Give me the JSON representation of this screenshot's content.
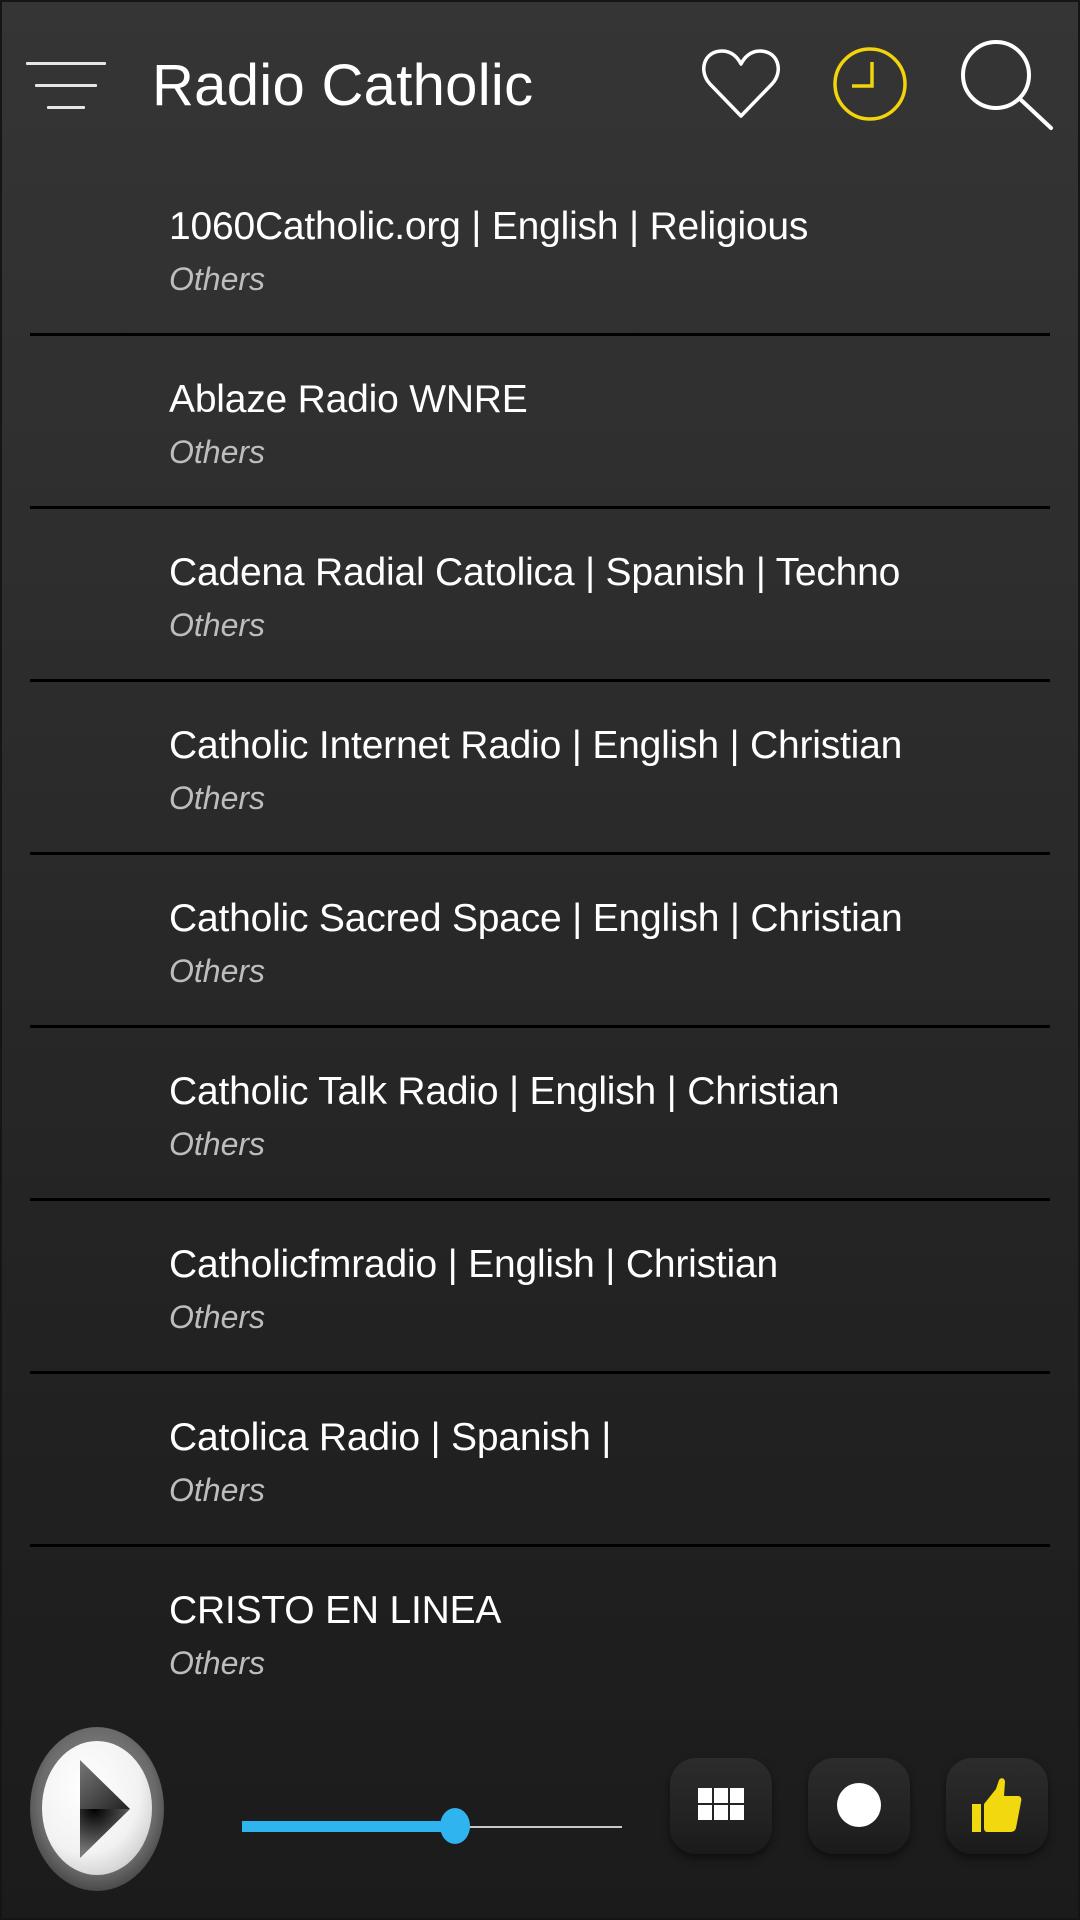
{
  "header": {
    "title": "Radio Catholic",
    "icons": {
      "menu": "hamburger-menu-icon",
      "favorites": "heart-icon",
      "recent": "clock-icon",
      "search": "search-icon"
    },
    "accent_color": "#F2D40C"
  },
  "stations": [
    {
      "name": "1060Catholic.org | English | Religious",
      "genre": "Others"
    },
    {
      "name": "Ablaze Radio WNRE",
      "genre": "Others"
    },
    {
      "name": "Cadena Radial Catolica | Spanish | Techno",
      "genre": "Others"
    },
    {
      "name": "Catholic Internet Radio | English | Christian",
      "genre": "Others"
    },
    {
      "name": "Catholic Sacred Space | English | Christian",
      "genre": "Others"
    },
    {
      "name": "Catholic Talk Radio | English | Christian",
      "genre": "Others"
    },
    {
      "name": "Catholicfmradio | English | Christian",
      "genre": "Others"
    },
    {
      "name": "Catolica Radio | Spanish |",
      "genre": "Others"
    },
    {
      "name": "CRISTO EN LINEA",
      "genre": "Others"
    }
  ],
  "player": {
    "play_icon": "play-icon",
    "volume_percent": 56,
    "volume_color": "#2FB4EF",
    "buttons": [
      {
        "name": "grid-view",
        "icon": "grid-icon"
      },
      {
        "name": "record",
        "icon": "record-dot-icon"
      },
      {
        "name": "rate",
        "icon": "thumbs-up-icon"
      }
    ]
  }
}
